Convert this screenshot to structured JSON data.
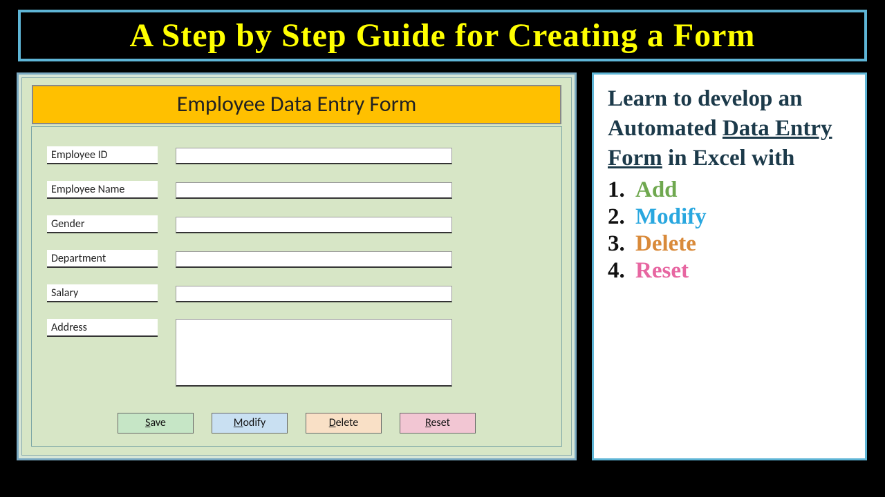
{
  "title": "A Step by Step Guide for Creating a Form",
  "form": {
    "header": "Employee Data Entry Form",
    "fields": [
      {
        "label": "Employee ID",
        "type": "text"
      },
      {
        "label": "Employee Name",
        "type": "text"
      },
      {
        "label": "Gender",
        "type": "text"
      },
      {
        "label": "Department",
        "type": "text"
      },
      {
        "label": "Salary",
        "type": "text"
      },
      {
        "label": "Address",
        "type": "textarea"
      }
    ],
    "buttons": {
      "save": "Save",
      "modify": "Modify",
      "delete": "Delete",
      "reset": "Reset"
    }
  },
  "info": {
    "lead_pre": "Learn to develop an Automated ",
    "lead_underline": "Data Entry Form",
    "lead_post": " in Excel with",
    "items": [
      {
        "num": "1.",
        "text": "Add",
        "color": "c-add"
      },
      {
        "num": "2.",
        "text": "Modify",
        "color": "c-modify"
      },
      {
        "num": "3.",
        "text": "Delete",
        "color": "c-delete"
      },
      {
        "num": "4.",
        "text": "Reset",
        "color": "c-reset"
      }
    ]
  }
}
